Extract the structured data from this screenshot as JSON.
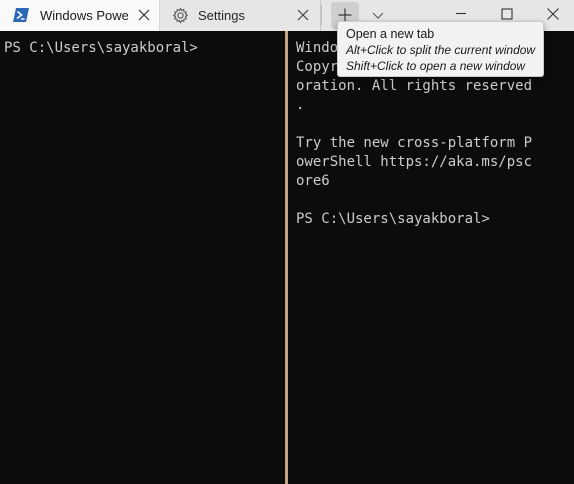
{
  "window": {
    "tabs": [
      {
        "title": "Windows PowerShell",
        "icon": "powershell-icon",
        "active": true
      },
      {
        "title": "Settings",
        "icon": "gear-icon",
        "active": false
      }
    ],
    "new_tab_icon": "plus-icon",
    "dropdown_icon": "chevron-down-icon",
    "caption_buttons": [
      "minimize-icon",
      "maximize-icon",
      "close-icon"
    ]
  },
  "tooltip": {
    "title": "Open a new tab",
    "line1": "Alt+Click to split the current window",
    "line2": "Shift+Click to open a new window"
  },
  "panes": {
    "left": {
      "lines": [
        "PS C:\\Users\\sayakboral>"
      ]
    },
    "right": {
      "lines": [
        "Windows PowerShell",
        "Copyright (C) Microsoft Corp",
        "oration. All rights reserved",
        ".",
        "",
        "Try the new cross-platform P",
        "owerShell https://aka.ms/psc",
        "ore6",
        "",
        "PS C:\\Users\\sayakboral>"
      ]
    }
  },
  "colors": {
    "terminal_bg": "#0c0c0c",
    "terminal_fg": "#cccccc",
    "tab_bar_bg": "#e6e6e6",
    "active_tab_bg": "#f9f9f9",
    "pane_separator": "#c7a67e",
    "powershell_blue": "#2b67b8"
  }
}
